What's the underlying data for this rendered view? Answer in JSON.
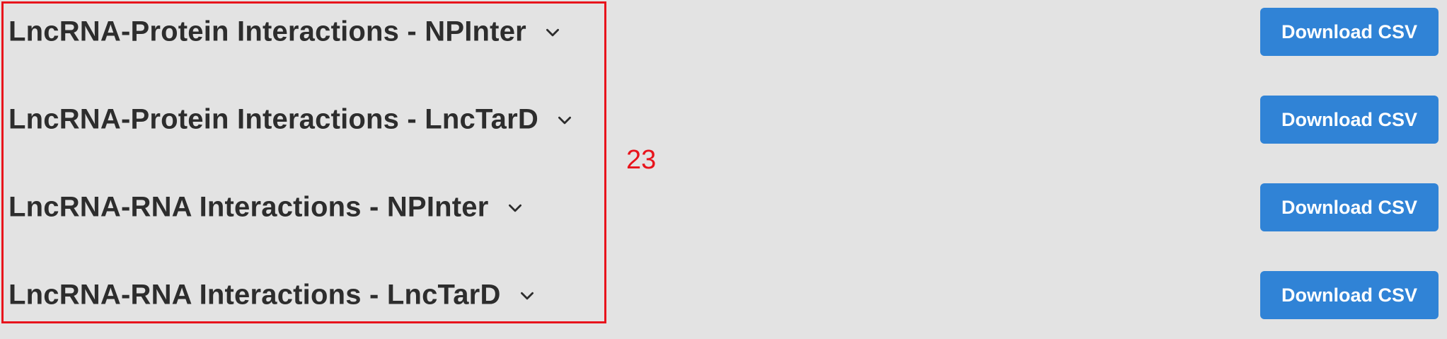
{
  "sections": [
    {
      "title": "LncRNA-Protein Interactions - NPInter",
      "button_label": "Download CSV",
      "icon": "chevron-down-icon"
    },
    {
      "title": "LncRNA-Protein Interactions - LncTarD",
      "button_label": "Download CSV",
      "icon": "chevron-down-icon"
    },
    {
      "title": "LncRNA-RNA Interactions - NPInter",
      "button_label": "Download CSV",
      "icon": "chevron-down-icon"
    },
    {
      "title": "LncRNA-RNA Interactions - LncTarD",
      "button_label": "Download CSV",
      "icon": "chevron-down-icon"
    }
  ],
  "annotation": {
    "label": "23",
    "color": "#e8141c"
  },
  "colors": {
    "background": "#e3e3e3",
    "button": "#3083d6",
    "title_text": "#2d2d2d"
  }
}
